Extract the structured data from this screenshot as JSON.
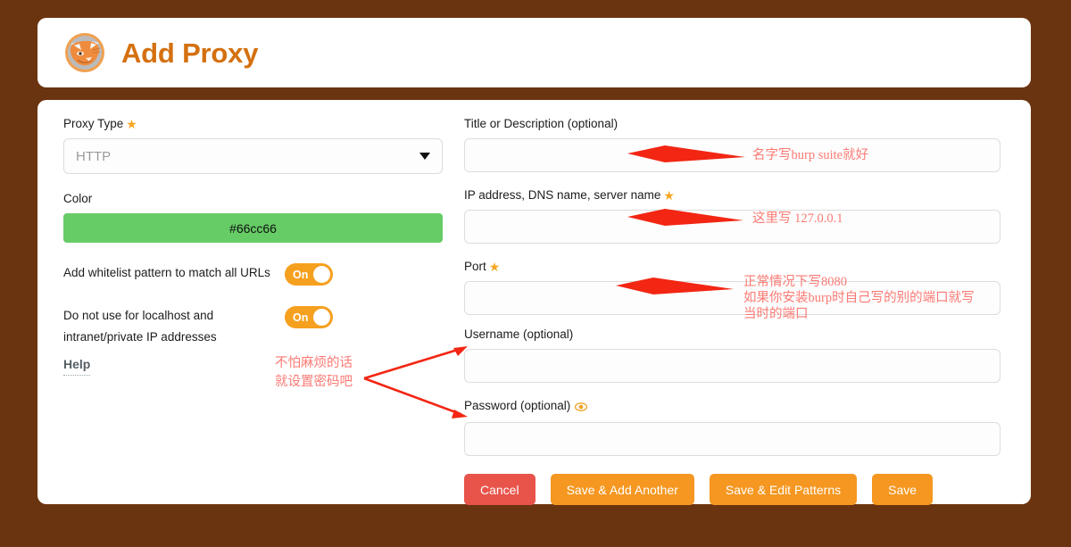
{
  "header": {
    "title": "Add Proxy",
    "logo_icon": "foxyproxy-fox-icon"
  },
  "form": {
    "left": {
      "proxy_type": {
        "label": "Proxy Type",
        "required_marker": "★",
        "value": "HTTP",
        "caret_icon": "chevron-down-icon"
      },
      "color": {
        "label": "Color",
        "value": "#66cc66",
        "swatch_hex": "#66cc66"
      },
      "whitelist_toggle": {
        "label": "Add whitelist pattern to match all URLs",
        "state": "On"
      },
      "localhost_toggle": {
        "label_line1": "Do not use for localhost and",
        "label_line2": "intranet/private IP addresses",
        "state": "On",
        "help_label": "Help"
      }
    },
    "right": {
      "title_field": {
        "label": "Title or Description (optional)",
        "value": "",
        "placeholder": ""
      },
      "address_field": {
        "label": "IP address, DNS name, server name",
        "required_marker": "★",
        "value": "",
        "placeholder": ""
      },
      "port_field": {
        "label": "Port",
        "required_marker": "★",
        "value": "",
        "placeholder": ""
      },
      "username_field": {
        "label": "Username (optional)",
        "value": "",
        "placeholder": ""
      },
      "password_field": {
        "label": "Password (optional)",
        "reveal_icon": "eye-icon",
        "value": "",
        "placeholder": ""
      }
    },
    "buttons": {
      "cancel": "Cancel",
      "save_add_another": "Save & Add Another",
      "save_edit_patterns": "Save & Edit Patterns",
      "save": "Save"
    }
  },
  "annotations": {
    "color": "#fb7a74",
    "arrow_color": "#f22613",
    "title_note": "名字写burp suite就好",
    "address_note": "这里写 127.0.0.1",
    "port_note_line1": "正常情况下写8080",
    "port_note_line2": "如果你安装burp时自己写的别的端口就写",
    "port_note_line3": "当时的端口",
    "credentials_note_line1": "不怕麻烦的话",
    "credentials_note_line2": "就设置密码吧"
  },
  "theme": {
    "page_background": "#6b3410",
    "card_background": "#ffffff",
    "title_color": "#d4700f",
    "accent_orange": "#f59720",
    "cancel_red": "#e8544a",
    "star_color": "#f5a623"
  }
}
